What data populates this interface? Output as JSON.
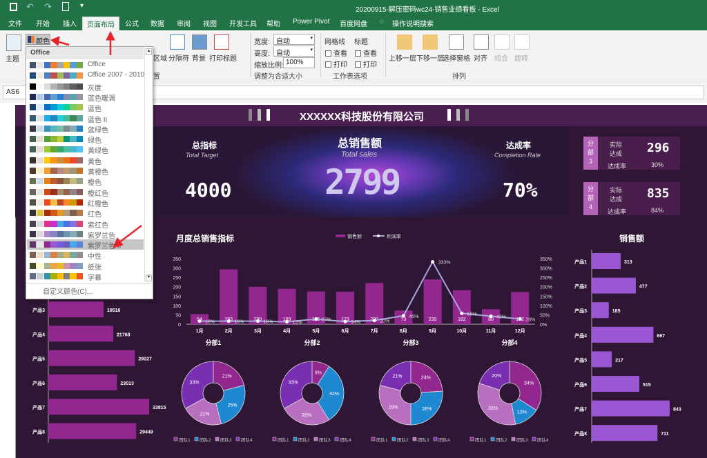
{
  "window": {
    "title": "20200915-解压密码wc24-销售业绩看板  -  Excel"
  },
  "tabs": [
    "文件",
    "开始",
    "插入",
    "页面布局",
    "公式",
    "数据",
    "审阅",
    "视图",
    "开发工具",
    "帮助",
    "Power Pivot",
    "百度网盘",
    "操作说明搜索"
  ],
  "active_tab": "页面布局",
  "ribbon": {
    "theme": "主题",
    "colors": "颜色",
    "area": "区域",
    "breaks": "分隔符",
    "background": "背景",
    "print_titles": "打印标题",
    "page_setup_group": "置",
    "width_label": "宽度:",
    "width_value": "自动",
    "height_label": "高度:",
    "height_value": "自动",
    "scale_label": "缩放比例:",
    "scale_value": "100%",
    "fit_group": "调整为合适大小",
    "gridlines": "网格线",
    "headings": "标题",
    "view": "查看",
    "print": "打印",
    "sheet_options_group": "工作表选项",
    "bring_forward": "上移一层",
    "send_backward": "下移一层",
    "selection_pane": "选择窗格",
    "align": "对齐",
    "group": "组合",
    "rotate": "旋转",
    "arrange_group": "排列"
  },
  "name_box": "AS6",
  "colors_dropdown": {
    "header": "Office",
    "selected": "紫罗兰色 II",
    "custom": "自定义颜色(C)...",
    "items": [
      {
        "label": "Office",
        "colors": [
          "#44546a",
          "#e7e6e6",
          "#4472c4",
          "#ed7d31",
          "#a5a5a5",
          "#ffc000",
          "#5b9bd5",
          "#70ad47"
        ]
      },
      {
        "label": "Office 2007 - 2010",
        "colors": [
          "#1f497d",
          "#eeece1",
          "#4f81bd",
          "#c0504d",
          "#9bbb59",
          "#8064a2",
          "#4bacc6",
          "#f79646"
        ]
      },
      {
        "label": "灰度",
        "colors": [
          "#000000",
          "#f8f8f8",
          "#dddddd",
          "#b2b2b2",
          "#969696",
          "#808080",
          "#5f5f5f",
          "#4d4d4d"
        ]
      },
      {
        "label": "蓝色暖调",
        "colors": [
          "#242852",
          "#acccea",
          "#4a66ac",
          "#629dd1",
          "#297fd5",
          "#7f8fa9",
          "#5aa2ae",
          "#9d90a0"
        ]
      },
      {
        "label": "蓝色",
        "colors": [
          "#17406d",
          "#dbeff9",
          "#0f6fc6",
          "#009dd9",
          "#0bd0d9",
          "#10cf9b",
          "#7cca62",
          "#a5c249"
        ]
      },
      {
        "label": "蓝色 II",
        "colors": [
          "#335b74",
          "#dfe3e5",
          "#1cade4",
          "#2683c6",
          "#27ced7",
          "#42ba97",
          "#3e8853",
          "#62a39f"
        ]
      },
      {
        "label": "蓝绿色",
        "colors": [
          "#373545",
          "#cedbe6",
          "#3494ba",
          "#58b6c0",
          "#75bda7",
          "#7a8c8e",
          "#84acb6",
          "#2683c6"
        ]
      },
      {
        "label": "绿色",
        "colors": [
          "#455f51",
          "#e3ded1",
          "#549e39",
          "#8ab833",
          "#c0cf3a",
          "#029676",
          "#4ab5c4",
          "#0989b1"
        ]
      },
      {
        "label": "黄绿色",
        "colors": [
          "#455f51",
          "#e3ded1",
          "#99cb38",
          "#63a537",
          "#37a76f",
          "#44c1a3",
          "#4eb3cf",
          "#51c3f9"
        ]
      },
      {
        "label": "黄色",
        "colors": [
          "#39302a",
          "#e5dedb",
          "#ffca08",
          "#f8931d",
          "#ce8d3e",
          "#ec7016",
          "#e64823",
          "#9c6a6a"
        ]
      },
      {
        "label": "黄橙色",
        "colors": [
          "#4e3b30",
          "#fbeec9",
          "#f0a22e",
          "#a5644e",
          "#b58b80",
          "#c3986d",
          "#a19574",
          "#c17529"
        ]
      },
      {
        "label": "橙色",
        "colors": [
          "#637052",
          "#ccddea",
          "#e48312",
          "#bd582c",
          "#865640",
          "#9b8357",
          "#c2bc80",
          "#94a088"
        ]
      },
      {
        "label": "橙红色",
        "colors": [
          "#696464",
          "#e9e5dc",
          "#d34817",
          "#9b2d1f",
          "#a28e6a",
          "#956251",
          "#918485",
          "#855d5d"
        ]
      },
      {
        "label": "红橙色",
        "colors": [
          "#505046",
          "#eeece1",
          "#e84c22",
          "#ffbd47",
          "#b64926",
          "#ff8427",
          "#cc9900",
          "#b22600"
        ]
      },
      {
        "label": "红色",
        "colors": [
          "#323232",
          "#e5c243",
          "#a5300f",
          "#d55816",
          "#e19825",
          "#b19c7d",
          "#7f5f52",
          "#b27d49"
        ]
      },
      {
        "label": "紫红色",
        "colors": [
          "#454551",
          "#d8d9dc",
          "#e32d91",
          "#c830cc",
          "#4ea6dc",
          "#4775e7",
          "#8971e1",
          "#d54773"
        ]
      },
      {
        "label": "紫罗兰色",
        "colors": [
          "#373545",
          "#dcd8dc",
          "#ad84c6",
          "#8784c7",
          "#5d739a",
          "#6997af",
          "#84acb6",
          "#6f8183"
        ]
      },
      {
        "label": "紫罗兰色 II",
        "colors": [
          "#632e62",
          "#eae5eb",
          "#92278f",
          "#9b57d3",
          "#755dd9",
          "#665eb8",
          "#45a5ed",
          "#5982db"
        ]
      },
      {
        "label": "中性",
        "colors": [
          "#7a6152",
          "#ebdcc9",
          "#94b6d2",
          "#dd8047",
          "#a5ab81",
          "#d8b25c",
          "#7ba79d",
          "#968c8c"
        ]
      },
      {
        "label": "纸张",
        "colors": [
          "#444d26",
          "#fefac9",
          "#a5b592",
          "#f3a447",
          "#e7bc29",
          "#d092a7",
          "#9c85c0",
          "#809ec2"
        ]
      },
      {
        "label": "字幕",
        "colors": [
          "#646b86",
          "#c5d1d7",
          "#3891a7",
          "#a5b000",
          "#feb80a",
          "#808080",
          "#ffc000",
          "#e95824"
        ]
      }
    ]
  },
  "dashboard": {
    "company": "XXXXXX科技股份有限公司",
    "total_target": {
      "label": "总指标",
      "sub": "Total Target",
      "value": "4000"
    },
    "total_sales": {
      "label": "总销售额",
      "sub": "Total sales",
      "value": "2799"
    },
    "completion": {
      "label": "达成率",
      "sub": "Completion Rate",
      "value": "70%"
    },
    "cards": [
      {
        "tag": [
          "分",
          "部",
          "3"
        ],
        "actual_label": "实际",
        "achieved_label": "达成",
        "value": "296",
        "rate_label": "达成率",
        "rate": "30%"
      },
      {
        "tag": [
          "分",
          "部",
          "4"
        ],
        "actual_label": "实际",
        "achieved_label": "达成",
        "value": "835",
        "rate_label": "达成率",
        "rate": "84%"
      }
    ]
  },
  "colors": {
    "bar": "#92278f",
    "line": "#a9a6dd",
    "team1": "#92278f",
    "team2": "#1e88d0",
    "team3": "#b96fbf",
    "team4": "#7a2fb2",
    "hbar_left": "#92278f",
    "hbar_right": "#9b57d3",
    "bg": "#2e1634"
  },
  "chart_data": [
    {
      "type": "bar",
      "title": "月度总销售指标",
      "categories": [
        "1月",
        "2月",
        "3月",
        "4月",
        "5月",
        "6月",
        "7月",
        "8月",
        "9月",
        "10月",
        "11月",
        "12月"
      ],
      "series": [
        {
          "name": "销售额",
          "type": "bar",
          "values": [
            54,
            293,
            200,
            189,
            175,
            173,
            220,
            73,
            239,
            182,
            80,
            172
          ]
        },
        {
          "name": "利润率",
          "type": "line",
          "axis": "right",
          "values": [
            16,
            16,
            16,
            13,
            27,
            14,
            20,
            45,
            333,
            58,
            43,
            28
          ],
          "unit": "%"
        }
      ],
      "ylim": [
        0,
        350
      ],
      "yticks": [
        0,
        50,
        100,
        150,
        200,
        250,
        300,
        350
      ],
      "y2lim": [
        0,
        350
      ],
      "y2ticks": [
        "0%",
        "50%",
        "100%",
        "150%",
        "200%",
        "250%",
        "300%",
        "350%"
      ],
      "legend": "top"
    },
    {
      "type": "pie",
      "title": "分部1",
      "categories": [
        "团队1",
        "团队2",
        "团队3",
        "团队4"
      ],
      "values": [
        21,
        25,
        21,
        33
      ]
    },
    {
      "type": "pie",
      "title": "分部2",
      "categories": [
        "团队1",
        "团队2",
        "团队3",
        "团队4"
      ],
      "values": [
        9,
        32,
        26,
        33
      ]
    },
    {
      "type": "pie",
      "title": "分部3",
      "categories": [
        "团队1",
        "团队2",
        "团队3",
        "团队4"
      ],
      "values": [
        24,
        26,
        29,
        21
      ]
    },
    {
      "type": "pie",
      "title": "分部4",
      "categories": [
        "团队1",
        "团队2",
        "团队3",
        "团队4"
      ],
      "values": [
        34,
        13,
        33,
        20
      ]
    },
    {
      "type": "bar",
      "orientation": "horizontal",
      "title": "",
      "categories": [
        "产品3",
        "产品4",
        "产品5",
        "产品6",
        "产品7",
        "产品8"
      ],
      "values": [
        18516,
        21768,
        29027,
        23013,
        33815,
        29449
      ]
    },
    {
      "type": "bar",
      "orientation": "horizontal",
      "title": "销售额",
      "categories": [
        "产品1",
        "产品2",
        "产品3",
        "产品4",
        "产品5",
        "产品6",
        "产品7",
        "产品8"
      ],
      "values": [
        313,
        477,
        185,
        667,
        217,
        515,
        843,
        711
      ]
    }
  ]
}
